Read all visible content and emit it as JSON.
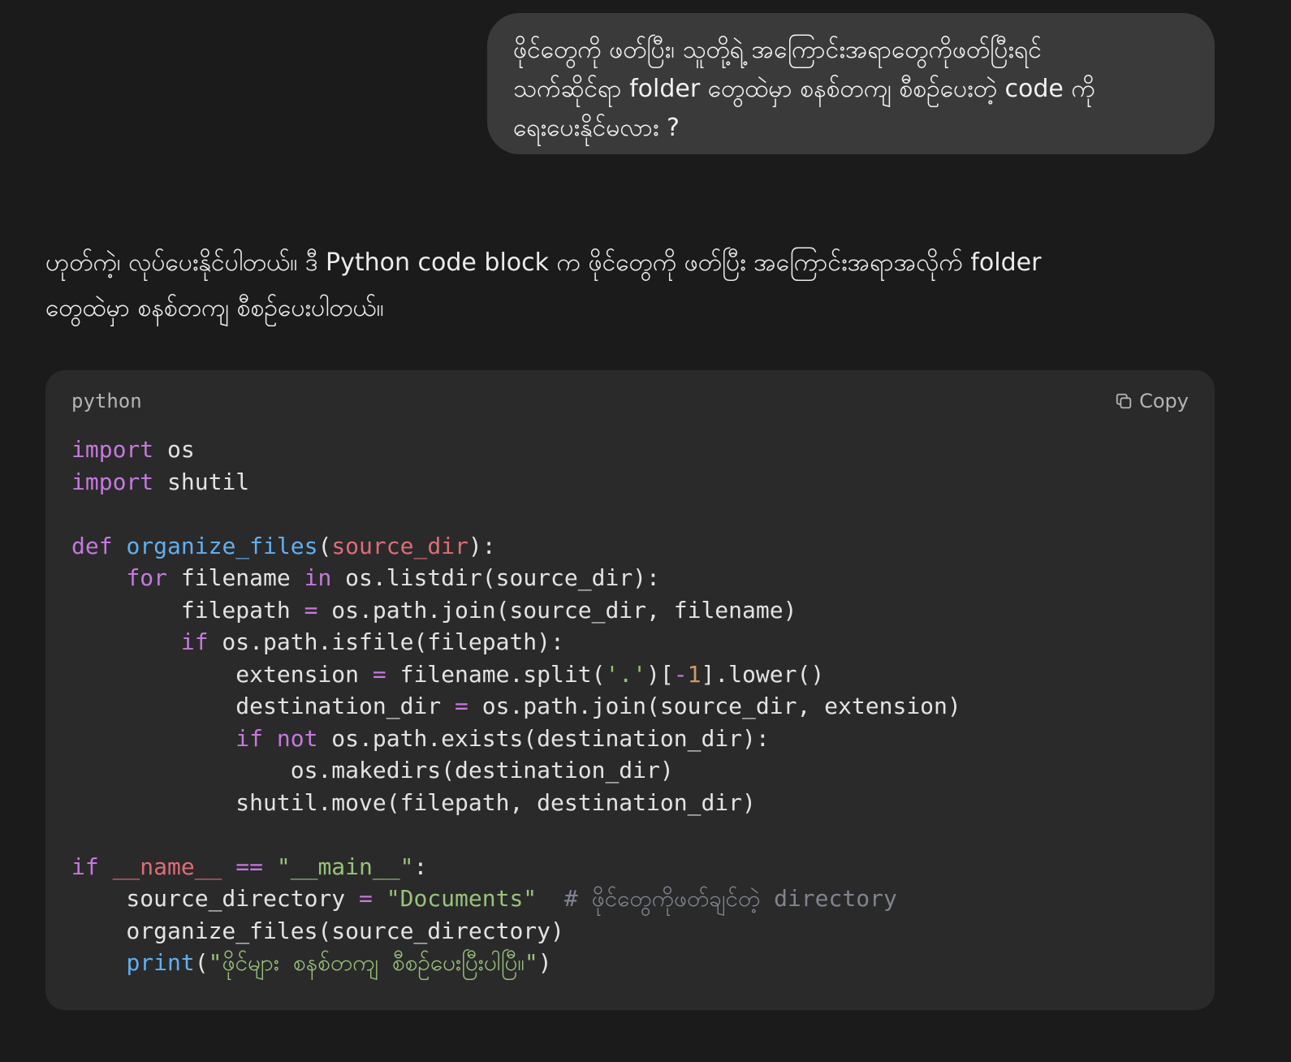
{
  "user_message": {
    "lines": [
      "ဖိုင်တွေကို ဖတ်ပြီး၊ သူတို့ရဲ့ အကြောင်းအရာတွေကိုဖတ်ပြီးရင်",
      "သက်ဆိုင်ရာ folder တွေထဲမှာ စနစ်တကျ စီစဉ်ပေးတဲ့ code ကို",
      "ရေးပေးနိုင်မလား ?"
    ]
  },
  "assistant_message": {
    "lines": [
      "ဟုတ်ကဲ့၊ လုပ်ပေးနိုင်ပါတယ်။ ဒီ Python code block က ဖိုင်တွေကို ဖတ်ပြီး အကြောင်းအရာအလိုက် folder",
      "တွေထဲမှာ စနစ်တကျ စီစဉ်ပေးပါတယ်။"
    ]
  },
  "code_block": {
    "language": "python",
    "copy_label": "Copy",
    "lines": [
      [
        {
          "t": "import",
          "c": "kw"
        },
        {
          "t": " os",
          "c": "txt"
        }
      ],
      [
        {
          "t": "import",
          "c": "kw"
        },
        {
          "t": " shutil",
          "c": "txt"
        }
      ],
      [],
      [
        {
          "t": "def",
          "c": "kw"
        },
        {
          "t": " ",
          "c": "txt"
        },
        {
          "t": "organize_files",
          "c": "fn"
        },
        {
          "t": "(",
          "c": "txt"
        },
        {
          "t": "source_dir",
          "c": "param"
        },
        {
          "t": "):",
          "c": "txt"
        }
      ],
      [
        {
          "t": "    ",
          "c": "txt"
        },
        {
          "t": "for",
          "c": "kw"
        },
        {
          "t": " filename ",
          "c": "txt"
        },
        {
          "t": "in",
          "c": "kw"
        },
        {
          "t": " os.listdir(source_dir):",
          "c": "txt"
        }
      ],
      [
        {
          "t": "        filepath ",
          "c": "txt"
        },
        {
          "t": "=",
          "c": "kw"
        },
        {
          "t": " os.path.join(source_dir, filename)",
          "c": "txt"
        }
      ],
      [
        {
          "t": "        ",
          "c": "txt"
        },
        {
          "t": "if",
          "c": "kw"
        },
        {
          "t": " os.path.isfile(filepath):",
          "c": "txt"
        }
      ],
      [
        {
          "t": "            extension ",
          "c": "txt"
        },
        {
          "t": "=",
          "c": "kw"
        },
        {
          "t": " filename.split(",
          "c": "txt"
        },
        {
          "t": "'.'",
          "c": "str"
        },
        {
          "t": ")[",
          "c": "txt"
        },
        {
          "t": "-",
          "c": "kw"
        },
        {
          "t": "1",
          "c": "num"
        },
        {
          "t": "].lower()",
          "c": "txt"
        }
      ],
      [
        {
          "t": "            destination_dir ",
          "c": "txt"
        },
        {
          "t": "=",
          "c": "kw"
        },
        {
          "t": " os.path.join(source_dir, extension)",
          "c": "txt"
        }
      ],
      [
        {
          "t": "            ",
          "c": "txt"
        },
        {
          "t": "if",
          "c": "kw"
        },
        {
          "t": " ",
          "c": "txt"
        },
        {
          "t": "not",
          "c": "kw"
        },
        {
          "t": " os.path.exists(destination_dir):",
          "c": "txt"
        }
      ],
      [
        {
          "t": "                os.makedirs(destination_dir)",
          "c": "txt"
        }
      ],
      [
        {
          "t": "            shutil.move(filepath, destination_dir)",
          "c": "txt"
        }
      ],
      [],
      [
        {
          "t": "if",
          "c": "kw"
        },
        {
          "t": " ",
          "c": "txt"
        },
        {
          "t": "__name__",
          "c": "param"
        },
        {
          "t": " ",
          "c": "txt"
        },
        {
          "t": "==",
          "c": "kw"
        },
        {
          "t": " ",
          "c": "txt"
        },
        {
          "t": "\"__main__\"",
          "c": "str"
        },
        {
          "t": ":",
          "c": "txt"
        }
      ],
      [
        {
          "t": "    source_directory ",
          "c": "txt"
        },
        {
          "t": "=",
          "c": "kw"
        },
        {
          "t": " ",
          "c": "txt"
        },
        {
          "t": "\"Documents\"",
          "c": "str"
        },
        {
          "t": "  ",
          "c": "txt"
        },
        {
          "t": "# ဖိုင်တွေကိုဖတ်ချင်တဲ့ directory",
          "c": "cmt"
        }
      ],
      [
        {
          "t": "    organize_files(source_directory)",
          "c": "txt"
        }
      ],
      [
        {
          "t": "    ",
          "c": "txt"
        },
        {
          "t": "print",
          "c": "fn"
        },
        {
          "t": "(",
          "c": "txt"
        },
        {
          "t": "\"ဖိုင်များ စနစ်တကျ စီစဉ်ပေးပြီးပါပြီ။\"",
          "c": "str"
        },
        {
          "t": ")",
          "c": "txt"
        }
      ]
    ]
  }
}
